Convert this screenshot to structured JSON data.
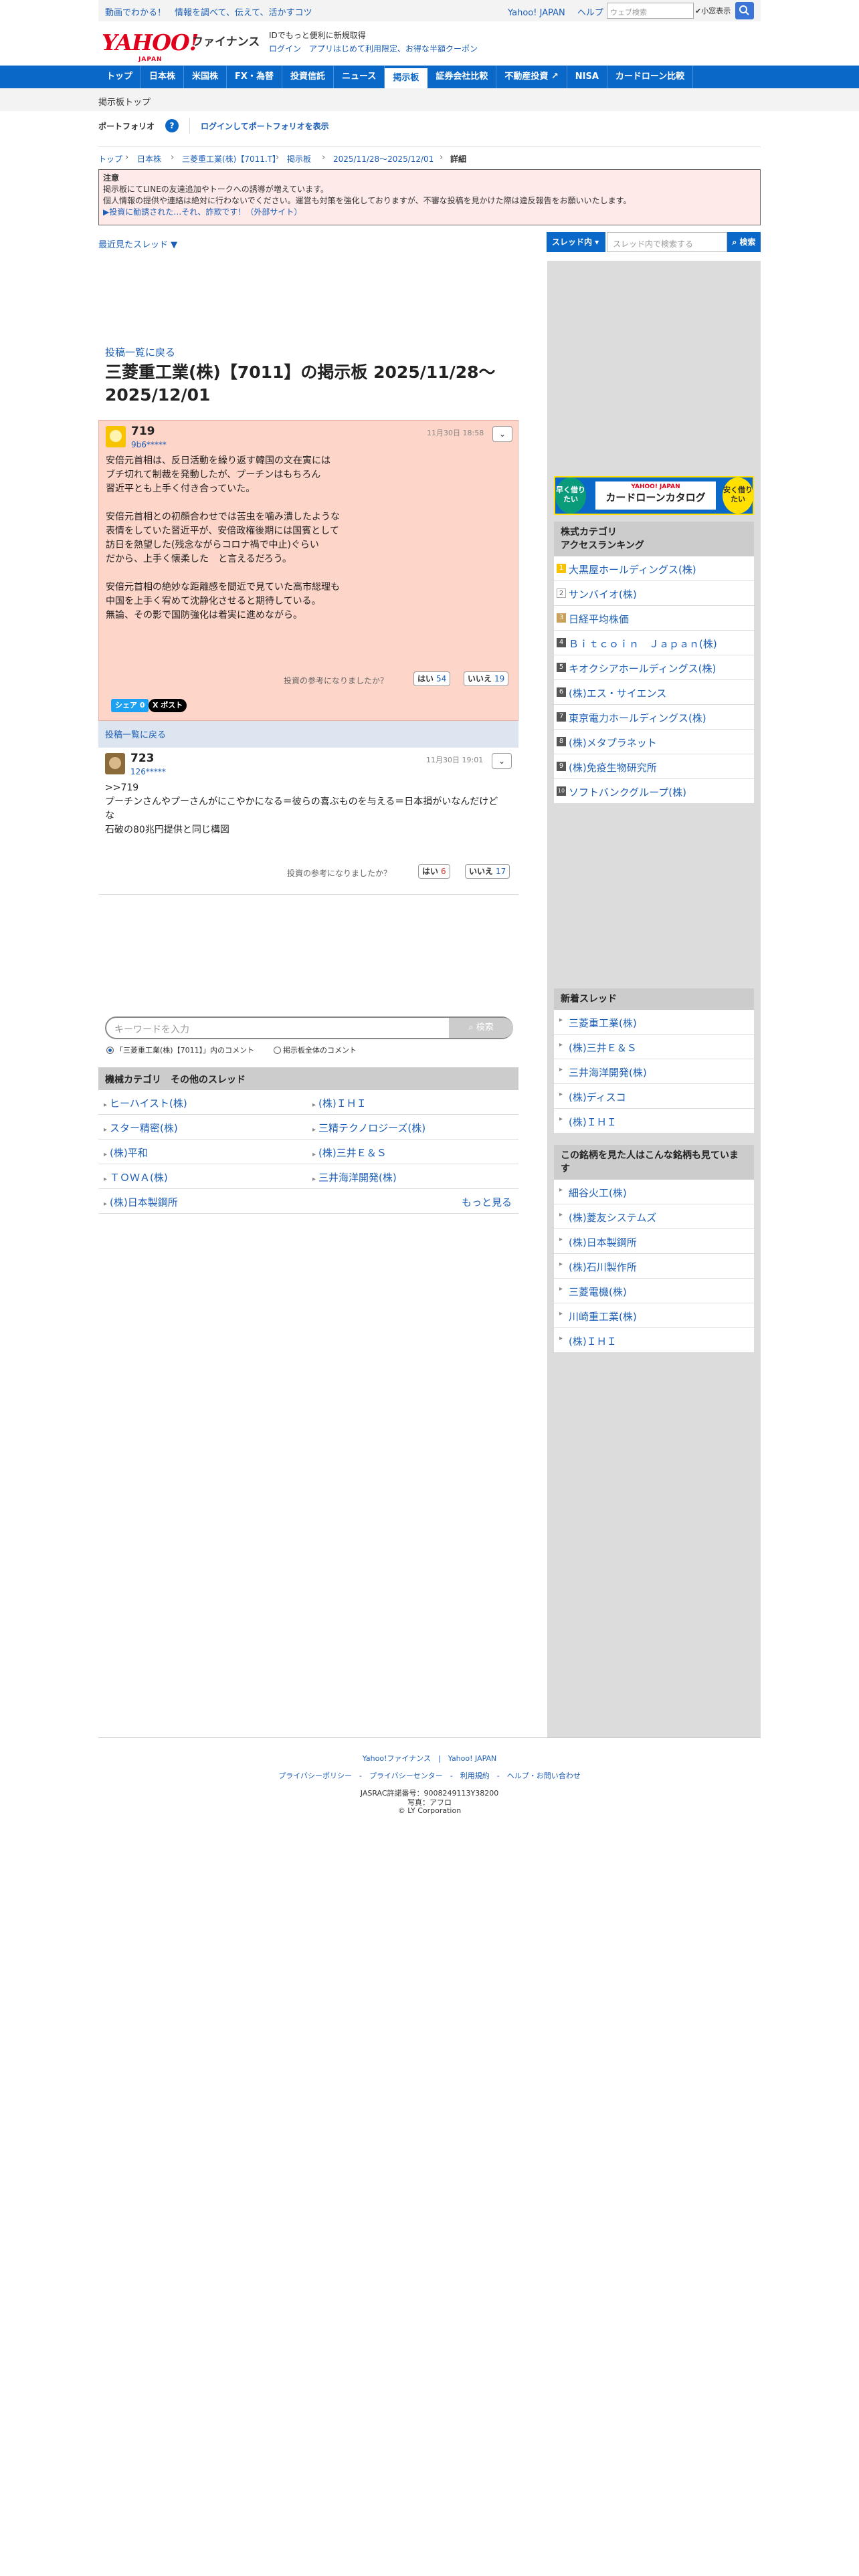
{
  "promo": {
    "text": "動画でわかる！　情報を調べて、伝えて、活かすコツ",
    "links": [
      "Yahoo! JAPAN",
      "ヘルプ"
    ],
    "search_placeholder": "ウェブ検索",
    "dict_label": "小窓表示",
    "search_icon": "search-icon"
  },
  "header": {
    "logo": "YAHOO!",
    "logo_sub": "JAPAN",
    "service": "ファイナンス",
    "msg1": "IDでもっと便利に新規取得",
    "msg2": "ログイン　アプリはじめて利用限定、お得な半額クーポン"
  },
  "nav": {
    "items": [
      "トップ",
      "日本株",
      "米国株",
      "FX・為替",
      "投資信託",
      "ニュース",
      "掲示板",
      "証券会社比較",
      "不動産投資 ↗",
      "NISA",
      "カードローン比較"
    ],
    "active": "掲示板"
  },
  "subnav": {
    "label": "掲示板トップ"
  },
  "portfolio": {
    "title": "ポートフォリオ",
    "help": "?",
    "link": "ログインしてポートフォリオを表示"
  },
  "breadcrumb": [
    "トップ",
    "日本株",
    "三菱重工業(株)【7011.T】",
    "掲示板",
    "2025/11/28〜2025/12/01",
    "詳細"
  ],
  "notice": {
    "title": "注意",
    "line1": "掲示板にてLINEの友達追加やトークへの誘導が増えています。",
    "line2": "個人情報の提供や連絡は絶対に行わないでください。運営も対策を強化しておりますが、不審な投稿を見かけた際は違反報告をお願いいたします。",
    "link": "▶投資に勧誘された…それ、詐欺です！（外部サイト）"
  },
  "threadbar": {
    "recent": "最近見たスレッド ▼",
    "scope": "スレッド内 ▾",
    "placeholder": "スレッド内で検索する",
    "button": "検索"
  },
  "main": {
    "back_link": "投稿一覧に戻る",
    "title": "三菱重工業(株)【7011】の掲示板 2025/11/28〜2025/12/01",
    "comments": [
      {
        "num": "719",
        "user": "9b6*****",
        "date": "11月30日 18:58",
        "body": "安倍元首相は、反日活動を繰り返す韓国の文在寅には\nブチ切れて制裁を発動したが、プーチンはもちろん\n習近平とも上手く付き合っていた。\n\n安倍元首相との初顔合わせでは苦虫を噛み潰したような\n表情をしていた習近平が、安倍政権後期には国賓として\n訪日を熱望した(残念ながらコロナ禍で中止)ぐらい\nだから、上手く懐柔した　と言えるだろう。\n\n安倍元首相の絶妙な距離感を間近で見ていた高市総理も\n中国を上手く宥めて沈静化させると期待している。\n無論、その影で国防強化は着実に進めながら。",
        "vote_q": "投資の参考になりましたか？",
        "yes": "はい",
        "yes_n": "54",
        "no": "いいえ",
        "no_n": "19"
      },
      {
        "num": "723",
        "user": "126*****",
        "date": "11月30日 19:01",
        "body": ">>719\nプーチンさんやプーさんがにこやかになる＝彼らの喜ぶものを与える＝日本損がいなんだけどな\n石破の80兆円提供と同じ構図",
        "vote_q": "投資の参考になりましたか？",
        "yes": "はい",
        "yes_n": "6",
        "no": "いいえ",
        "no_n": "17"
      }
    ],
    "share_fb": "シェア 0",
    "share_x": "X ポスト",
    "back_link2": "投稿一覧に戻る",
    "kw_placeholder": "キーワードを入力",
    "kw_button": "検索",
    "radio1": "「三菱重工業(株)【7011】」内のコメント",
    "radio2": "掲示板全体のコメント"
  },
  "others": {
    "title": "機械カテゴリ　その他のスレッド",
    "rows": [
      [
        "ヒーハイスト(株)",
        "(株)ＩＨＩ"
      ],
      [
        "スター精密(株)",
        "三精テクノロジーズ(株)"
      ],
      [
        "(株)平和",
        "(株)三井Ｅ＆Ｓ"
      ],
      [
        "ＴＯＷＡ(株)",
        "三井海洋開発(株)"
      ]
    ],
    "last": "(株)日本製鋼所",
    "more": "もっと見る"
  },
  "sidebar": {
    "loan": {
      "left": "早く借りたい",
      "brand": "YAHOO! JAPAN",
      "title": "カードローンカタログ",
      "right": "安く借りたい"
    },
    "ranking_title1": "株式カテゴリ",
    "ranking_title2": "アクセスランキング",
    "ranking": [
      {
        "rank": "1",
        "name": "大黒屋ホールディングス(株)"
      },
      {
        "rank": "2",
        "name": "サンバイオ(株)"
      },
      {
        "rank": "3",
        "name": "日経平均株価"
      },
      {
        "rank": "4",
        "name": "Ｂｉｔｃｏｉｎ　Ｊａｐａｎ(株)"
      },
      {
        "rank": "5",
        "name": "キオクシアホールディングス(株)"
      },
      {
        "rank": "6",
        "name": "(株)エス・サイエンス"
      },
      {
        "rank": "7",
        "name": "東京電力ホールディングス(株)"
      },
      {
        "rank": "8",
        "name": "(株)メタプラネット"
      },
      {
        "rank": "9",
        "name": "(株)免疫生物研究所"
      },
      {
        "rank": "10",
        "name": "ソフトバンクグループ(株)"
      }
    ],
    "new_title": "新着スレッド",
    "new_threads": [
      "三菱重工業(株)",
      "(株)三井Ｅ＆Ｓ",
      "三井海洋開発(株)",
      "(株)ディスコ",
      "(株)ＩＨＩ"
    ],
    "related_title": "この銘柄を見た人はこんな銘柄も見ています",
    "related": [
      "細谷火工(株)",
      "(株)菱友システムズ",
      "(株)日本製鋼所",
      "(株)石川製作所",
      "三菱電機(株)",
      "川崎重工業(株)",
      "(株)ＩＨＩ"
    ]
  },
  "footer": {
    "line1": "Yahoo!ファイナンス　|　Yahoo! JAPAN",
    "line2": "プライバシーポリシー　-　プライバシーセンター　-　利用規約　-　ヘルプ・お問い合わせ",
    "line3": "JASRAC許諾番号：9008249113Y38200",
    "line4": "写真：アフロ",
    "line5": "© LY Corporation"
  }
}
